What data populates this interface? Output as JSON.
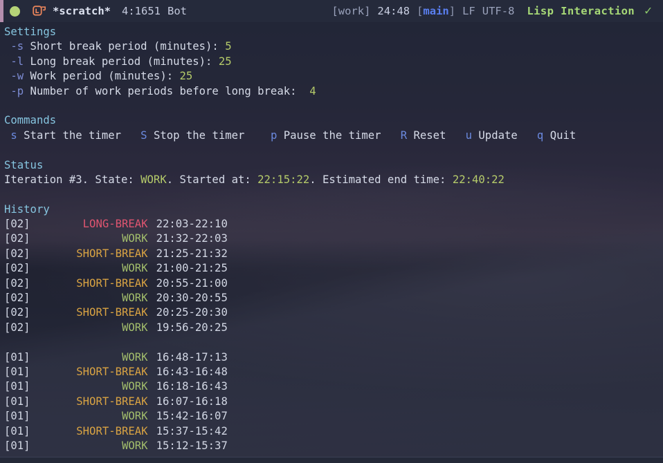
{
  "modeline": {
    "status_dot": "green-dot",
    "mode_icon": "lisp-mode-icon",
    "buffer_name": "*scratch*",
    "position": "4:1651",
    "scroll_state": "Bot",
    "project": "[work]",
    "clock": "24:48",
    "branch_open": "[",
    "branch": "main",
    "branch_close": "]",
    "eol": "LF",
    "encoding": "UTF-8",
    "major_mode": "Lisp Interaction",
    "check_icon": "✓"
  },
  "settings": {
    "heading": "Settings",
    "rows": [
      {
        "flag": "-s",
        "label": " Short break period (minutes): ",
        "value": "5"
      },
      {
        "flag": "-l",
        "label": " Long break period (minutes): ",
        "value": "25"
      },
      {
        "flag": "-w",
        "label": " Work period (minutes): ",
        "value": "25"
      },
      {
        "flag": "-p",
        "label": " Number of work periods before long break:  ",
        "value": "4"
      }
    ]
  },
  "commands": {
    "heading": "Commands",
    "items": [
      {
        "key": "s",
        "text": " Start the timer",
        "gap": "   "
      },
      {
        "key": "S",
        "text": " Stop the timer",
        "gap": "    "
      },
      {
        "key": "p",
        "text": " Pause the timer",
        "gap": "   "
      },
      {
        "key": "R",
        "text": " Reset",
        "gap": "   "
      },
      {
        "key": "u",
        "text": " Update",
        "gap": "   "
      },
      {
        "key": "q",
        "text": " Quit",
        "gap": ""
      }
    ]
  },
  "status": {
    "heading": "Status",
    "prefix": "Iteration #3. State: ",
    "state": "WORK",
    "middle": ". Started at: ",
    "started_at": "22:15:22",
    "suffix": ". Estimated end time: ",
    "end_time": "22:40:22"
  },
  "history": {
    "heading": "History",
    "groups": [
      {
        "rows": [
          {
            "iter": "[02]",
            "state": "LONG-BREAK",
            "state_class": "st-long-break",
            "range": "22:03-22:10"
          },
          {
            "iter": "[02]",
            "state": "WORK",
            "state_class": "st-work",
            "range": "21:32-22:03"
          },
          {
            "iter": "[02]",
            "state": "SHORT-BREAK",
            "state_class": "st-short-break",
            "range": "21:25-21:32"
          },
          {
            "iter": "[02]",
            "state": "WORK",
            "state_class": "st-work",
            "range": "21:00-21:25"
          },
          {
            "iter": "[02]",
            "state": "SHORT-BREAK",
            "state_class": "st-short-break",
            "range": "20:55-21:00"
          },
          {
            "iter": "[02]",
            "state": "WORK",
            "state_class": "st-work",
            "range": "20:30-20:55"
          },
          {
            "iter": "[02]",
            "state": "SHORT-BREAK",
            "state_class": "st-short-break",
            "range": "20:25-20:30"
          },
          {
            "iter": "[02]",
            "state": "WORK",
            "state_class": "st-work",
            "range": "19:56-20:25"
          }
        ]
      },
      {
        "rows": [
          {
            "iter": "[01]",
            "state": "WORK",
            "state_class": "st-work",
            "range": "16:48-17:13"
          },
          {
            "iter": "[01]",
            "state": "SHORT-BREAK",
            "state_class": "st-short-break",
            "range": "16:43-16:48"
          },
          {
            "iter": "[01]",
            "state": "WORK",
            "state_class": "st-work",
            "range": "16:18-16:43"
          },
          {
            "iter": "[01]",
            "state": "SHORT-BREAK",
            "state_class": "st-short-break",
            "range": "16:07-16:18"
          },
          {
            "iter": "[01]",
            "state": "WORK",
            "state_class": "st-work",
            "range": "15:42-16:07"
          },
          {
            "iter": "[01]",
            "state": "SHORT-BREAK",
            "state_class": "st-short-break",
            "range": "15:37-15:42"
          },
          {
            "iter": "[01]",
            "state": "WORK",
            "state_class": "st-work",
            "range": "15:12-15:37"
          }
        ]
      }
    ]
  },
  "colors": {
    "background": "#262b3c",
    "modeline_bg": "#252a3b",
    "section_heading": "#86c5e0",
    "work": "#a3be6c",
    "short_break": "#d9a343",
    "long_break": "#e05570",
    "key": "#6b8ae0",
    "flag": "#7d8cd4",
    "value": "#b5cb6a",
    "major_mode": "#a7d977",
    "accent_edge": "#b48ead"
  }
}
